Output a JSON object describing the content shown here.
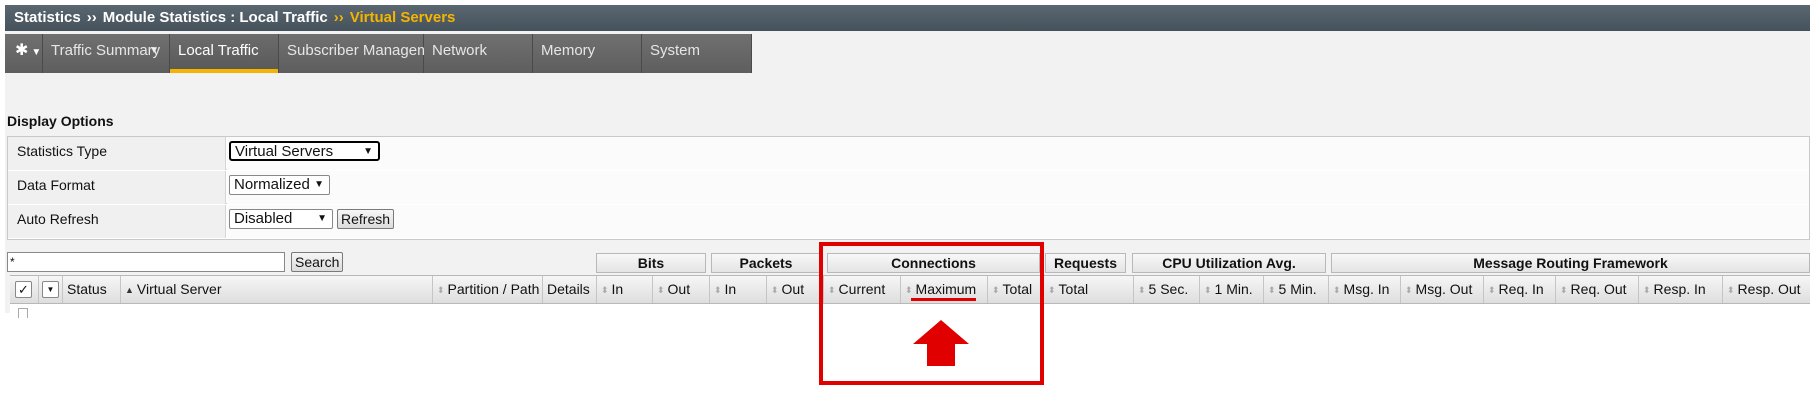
{
  "breadcrumb": {
    "item1": "Statistics",
    "sep": "››",
    "item2": "Module Statistics : Local Traffic",
    "current": "Virtual Servers"
  },
  "tabs": {
    "gear_icon": "gear-icon",
    "items": [
      {
        "label": "Traffic Summary",
        "has_caret": true
      },
      {
        "label": "Local Traffic",
        "active": true
      },
      {
        "label": "Subscriber Management"
      },
      {
        "label": "Network"
      },
      {
        "label": "Memory"
      },
      {
        "label": "System"
      }
    ]
  },
  "display_options": {
    "title": "Display Options",
    "rows": [
      {
        "label": "Statistics Type",
        "value": "Virtual Servers"
      },
      {
        "label": "Data Format",
        "value": "Normalized"
      },
      {
        "label": "Auto Refresh",
        "value": "Disabled",
        "button": "Refresh"
      }
    ]
  },
  "filter": {
    "value": "*",
    "button": "Search"
  },
  "table": {
    "groups": {
      "bits": "Bits",
      "packets": "Packets",
      "connections": "Connections",
      "requests": "Requests",
      "cpu": "CPU Utilization Avg.",
      "mrf": "Message Routing Framework"
    },
    "columns": {
      "status": "Status",
      "virtual_server": "Virtual Server",
      "partition_path": "Partition / Path",
      "details": "Details",
      "bits_in": "In",
      "bits_out": "Out",
      "packets_in": "In",
      "packets_out": "Out",
      "conn_current": "Current",
      "conn_maximum": "Maximum",
      "conn_total": "Total",
      "req_total": "Total",
      "cpu_5sec": "5 Sec.",
      "cpu_1min": "1 Min.",
      "cpu_5min": "5 Min.",
      "msg_in": "Msg. In",
      "msg_out": "Msg. Out",
      "req_in": "Req. In",
      "req_out": "Req. Out",
      "resp_in": "Resp. In",
      "resp_out": "Resp. Out"
    }
  },
  "colors": {
    "accent": "#f5b400",
    "annotation": "#e00000",
    "header_bar": "#4f5b64"
  }
}
